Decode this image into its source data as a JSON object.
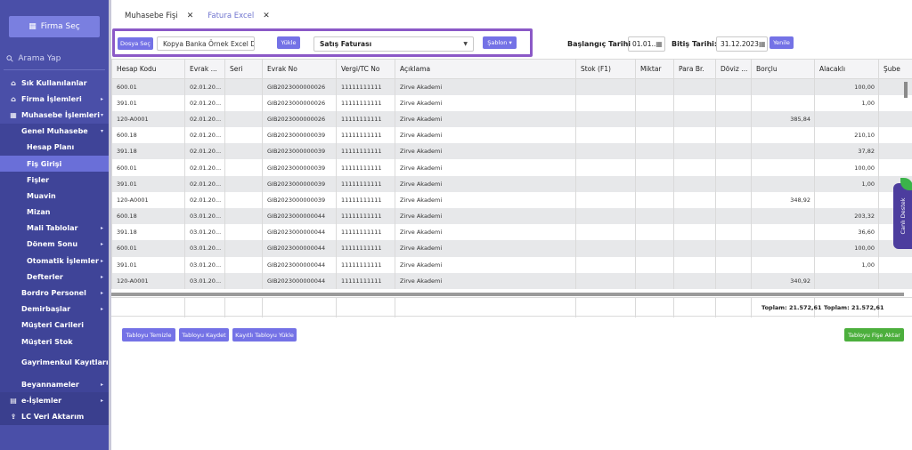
{
  "sidebar": {
    "firma_button": "Firma Seç",
    "search_placeholder": "Arama Yap",
    "items": [
      {
        "label": "Sık Kullanılanlar",
        "icon": "home-icon"
      },
      {
        "label": "Firma İşlemleri",
        "icon": "home-icon",
        "arrow": "▸"
      },
      {
        "label": "Muhasebe İşlemleri",
        "icon": "grid-icon",
        "arrow": "▾"
      },
      {
        "label": "Genel Muhasebe",
        "arrow": "▾"
      },
      {
        "label": "Hesap Planı"
      },
      {
        "label": "Fiş Girişi"
      },
      {
        "label": "Fişler"
      },
      {
        "label": "Muavin"
      },
      {
        "label": "Mizan"
      },
      {
        "label": "Mali Tablolar",
        "arrow": "▸"
      },
      {
        "label": "Dönem Sonu",
        "arrow": "▸"
      },
      {
        "label": "Otomatik İşlemler",
        "arrow": "▸"
      },
      {
        "label": "Defterler",
        "arrow": "▸"
      },
      {
        "label": "Bordro Personel",
        "arrow": "▸"
      },
      {
        "label": "Demirbaşlar",
        "arrow": "▸"
      },
      {
        "label": "Müşteri Carileri"
      },
      {
        "label": "Müşteri Stok"
      },
      {
        "label": "Gayrimenkul Kayıtları"
      },
      {
        "label": "Beyannameler",
        "arrow": "▸"
      },
      {
        "label": "e-İşlemler",
        "icon": "document-icon",
        "arrow": "▸"
      },
      {
        "label": "LC Veri Aktarım",
        "icon": "upload-icon"
      }
    ]
  },
  "tabs": [
    {
      "label": "Muhasebe Fişi"
    },
    {
      "label": "Fatura Excel"
    }
  ],
  "toolbar": {
    "file_button": "Dosya Seç",
    "file_name": "Kopya Banka Örnek Excel Dos",
    "load_button": "Yükle",
    "invoice_type": "Satış Faturası",
    "template_button": "Şablon ▾",
    "start_label": "Başlangıç Tarihi",
    "start_value": "01.01..",
    "end_label": "Bitiş Tarihi:",
    "end_value": "31.12.2023",
    "refresh_button": "Yenile"
  },
  "table": {
    "columns": [
      "Hesap Kodu",
      "Evrak ...",
      "Seri",
      "Evrak No",
      "Vergi/TC No",
      "Açıklama",
      "Stok (F1)",
      "Miktar",
      "Para Br.",
      "Döviz ...",
      "Borçlu",
      "Alacaklı",
      "Şube"
    ],
    "rows": [
      [
        "600.01",
        "02.01.20...",
        "",
        "GIB2023000000026",
        "11111111111",
        "Zirve Akademi",
        "",
        "",
        "",
        "",
        "",
        "100,00",
        ""
      ],
      [
        "391.01",
        "02.01.20...",
        "",
        "GIB2023000000026",
        "11111111111",
        "Zirve Akademi",
        "",
        "",
        "",
        "",
        "",
        "1,00",
        ""
      ],
      [
        "120-A0001",
        "02.01.20...",
        "",
        "GIB2023000000026",
        "11111111111",
        "Zirve Akademi",
        "",
        "",
        "",
        "",
        "385,84",
        "",
        ""
      ],
      [
        "600.18",
        "02.01.20...",
        "",
        "GIB2023000000039",
        "11111111111",
        "Zirve Akademi",
        "",
        "",
        "",
        "",
        "",
        "210,10",
        ""
      ],
      [
        "391.18",
        "02.01.20...",
        "",
        "GIB2023000000039",
        "11111111111",
        "Zirve Akademi",
        "",
        "",
        "",
        "",
        "",
        "37,82",
        ""
      ],
      [
        "600.01",
        "02.01.20...",
        "",
        "GIB2023000000039",
        "11111111111",
        "Zirve Akademi",
        "",
        "",
        "",
        "",
        "",
        "100,00",
        ""
      ],
      [
        "391.01",
        "02.01.20...",
        "",
        "GIB2023000000039",
        "11111111111",
        "Zirve Akademi",
        "",
        "",
        "",
        "",
        "",
        "1,00",
        ""
      ],
      [
        "120-A0001",
        "02.01.20...",
        "",
        "GIB2023000000039",
        "11111111111",
        "Zirve Akademi",
        "",
        "",
        "",
        "",
        "348,92",
        "",
        ""
      ],
      [
        "600.18",
        "03.01.20...",
        "",
        "GIB2023000000044",
        "11111111111",
        "Zirve Akademi",
        "",
        "",
        "",
        "",
        "",
        "203,32",
        ""
      ],
      [
        "391.18",
        "03.01.20...",
        "",
        "GIB2023000000044",
        "11111111111",
        "Zirve Akademi",
        "",
        "",
        "",
        "",
        "",
        "36,60",
        ""
      ],
      [
        "600.01",
        "03.01.20...",
        "",
        "GIB2023000000044",
        "11111111111",
        "Zirve Akademi",
        "",
        "",
        "",
        "",
        "",
        "100,00",
        ""
      ],
      [
        "391.01",
        "03.01.20...",
        "",
        "GIB2023000000044",
        "11111111111",
        "Zirve Akademi",
        "",
        "",
        "",
        "",
        "",
        "1,00",
        ""
      ],
      [
        "120-A0001",
        "03.01.20...",
        "",
        "GIB2023000000044",
        "11111111111",
        "Zirve Akademi",
        "",
        "",
        "",
        "",
        "340,92",
        "",
        ""
      ]
    ],
    "total_debit": "Toplam: 21.572,61",
    "total_credit": "Toplam: 21.572,61"
  },
  "buttons": {
    "clear": "Tabloyu Temizle",
    "save": "Tabloyu Kaydet",
    "load_saved": "Kayıtlı Tabloyu Yükle",
    "transfer": "Tabloyu Fişe Aktar"
  },
  "support_tab": "Canlı Destek"
}
